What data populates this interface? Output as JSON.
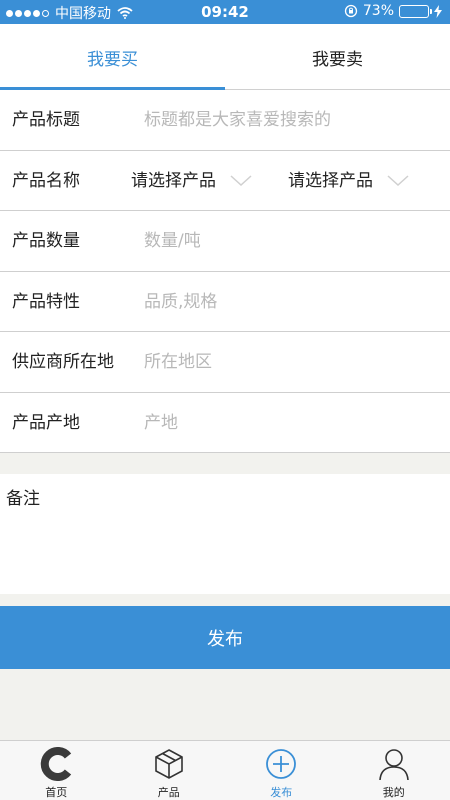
{
  "status_bar": {
    "carrier": "中国移动",
    "time": "09:42",
    "battery_percent_text": "73%",
    "battery_level": 0.73
  },
  "tabs": [
    {
      "label": "我要买",
      "active": true
    },
    {
      "label": "我要卖",
      "active": false
    }
  ],
  "form": {
    "title": {
      "label": "产品标题",
      "placeholder": "标题都是大家喜爱搜索的"
    },
    "name": {
      "label": "产品名称",
      "select_a": "请选择产品",
      "select_b": "请选择产品"
    },
    "quantity": {
      "label": "产品数量",
      "placeholder": "数量/吨"
    },
    "features": {
      "label": "产品特性",
      "placeholder": "品质,规格"
    },
    "supplier_location": {
      "label": "供应商所在地",
      "placeholder": "所在地区"
    },
    "origin": {
      "label": "产品产地",
      "placeholder": "产地"
    }
  },
  "notes": {
    "label": "备注"
  },
  "publish_button": "发布",
  "bottom_nav": [
    {
      "label": "首页",
      "icon": "home-c-icon"
    },
    {
      "label": "产品",
      "icon": "cube-icon"
    },
    {
      "label": "发布",
      "icon": "plus-circle-icon",
      "active": true
    },
    {
      "label": "我的",
      "icon": "user-icon"
    }
  ],
  "colors": {
    "accent": "#3a8fd6",
    "background": "#f2f2ee",
    "placeholder": "#b8b8b8"
  }
}
